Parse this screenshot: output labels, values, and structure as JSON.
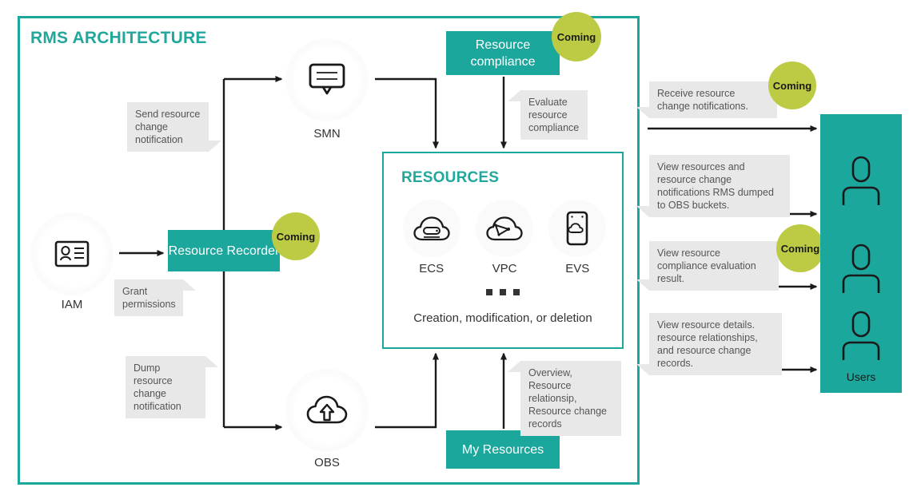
{
  "diagram": {
    "title": "RMS ARCHITECTURE",
    "colors": {
      "teal": "#1CA79C",
      "lime": "#BDCB44",
      "callout_bg": "#e8e8e8",
      "arrow": "#1a1a1a"
    }
  },
  "boxes": {
    "resource_compliance": "Resource compliance",
    "resource_recorder": "Resource Recorder",
    "my_resources": "My Resources"
  },
  "badges": {
    "compliance": "Coming",
    "recorder": "Coming",
    "receive_notifications": "Coming",
    "view_compliance": "Coming"
  },
  "services": {
    "smn": {
      "label": "SMN",
      "icon": "speech-bubble-icon"
    },
    "obs": {
      "label": "OBS",
      "icon": "cloud-upload-icon"
    },
    "iam": {
      "label": "IAM",
      "icon": "id-card-icon"
    }
  },
  "resources_panel": {
    "title": "RESOURCES",
    "items": [
      {
        "label": "ECS",
        "icon": "cloud-server-icon"
      },
      {
        "label": "VPC",
        "icon": "cloud-network-icon"
      },
      {
        "label": "EVS",
        "icon": "cloud-disk-icon"
      }
    ],
    "ellipsis": "...",
    "caption": "Creation, modification, or deletion"
  },
  "callouts": {
    "send_change": "Send resource change notification",
    "grant_permissions": "Grant permissions",
    "dump_change": "Dump resource change notification",
    "evaluate_compliance": "Evaluate resource compliance",
    "overview": "Overview, Resource relationsip, Resource change records"
  },
  "user_actions": [
    {
      "text": "Receive resource change notifications.",
      "badge": "Coming"
    },
    {
      "text": "View resources and resource change notifications RMS dumped to OBS buckets.",
      "badge": null
    },
    {
      "text": "View resource compliance evaluation result.",
      "badge": "Coming"
    },
    {
      "text": "View resource details. resource relationships, and resource change records.",
      "badge": null
    }
  ],
  "users_panel": {
    "label": "Users",
    "user_count": 3
  }
}
